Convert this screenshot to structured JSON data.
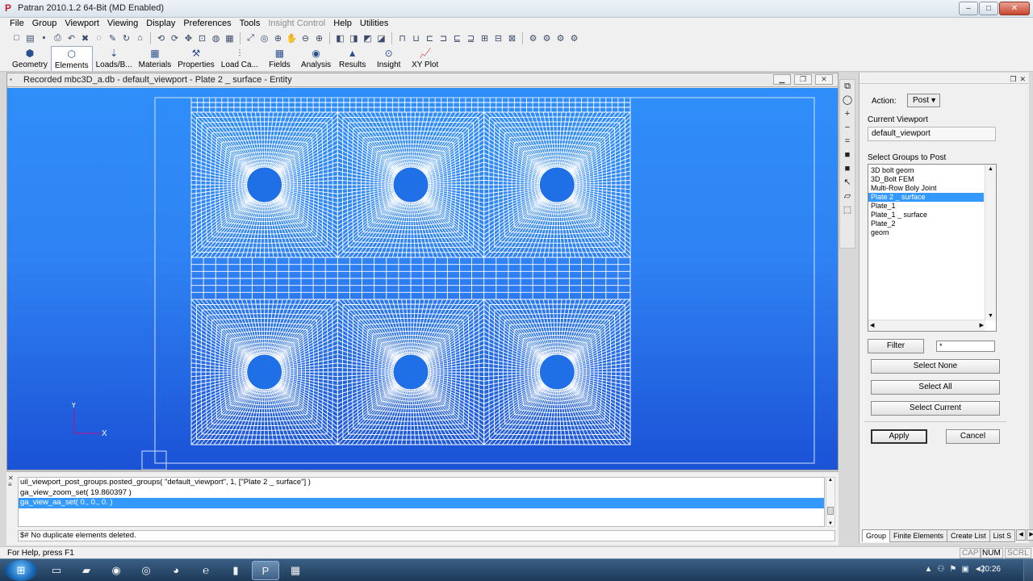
{
  "window": {
    "title": "Patran 2010.1.2 64-Bit (MD Enabled)",
    "app_icon": "P"
  },
  "menubar": [
    {
      "label": "File",
      "disabled": false
    },
    {
      "label": "Group",
      "disabled": false
    },
    {
      "label": "Viewport",
      "disabled": false
    },
    {
      "label": "Viewing",
      "disabled": false
    },
    {
      "label": "Display",
      "disabled": false
    },
    {
      "label": "Preferences",
      "disabled": false
    },
    {
      "label": "Tools",
      "disabled": false
    },
    {
      "label": "Insight Control",
      "disabled": true
    },
    {
      "label": "Help",
      "disabled": false
    },
    {
      "label": "Utilities",
      "disabled": false
    }
  ],
  "toolbar_icons": [
    "new-file-icon",
    "open-file-icon",
    "save-icon",
    "print-icon",
    "undo-icon",
    "abort-icon",
    "reset-graphics-icon",
    "pencil-icon",
    "refresh-icon",
    "home-icon",
    "rotate-icon",
    "rotate-2-icon",
    "translate-icon",
    "zoom-window-icon",
    "shade-icon",
    "view-front-icon",
    "fit-view-icon",
    "center-icon",
    "zoom-center-icon",
    "pan-icon",
    "zoom-out-icon",
    "zoom-in-icon",
    "iso-view-1-icon",
    "iso-view-2-icon",
    "iso-view-3-icon",
    "iso-view-4-icon",
    "view-top-icon",
    "view-bottom-icon",
    "view-front-2-icon",
    "view-rear-icon",
    "view-left-icon",
    "view-right-icon",
    "view-iso-icon",
    "view-persp-icon",
    "view-named-icon",
    "show-labels-icon",
    "hide-labels-icon",
    "label-options-icon",
    "entity-color-icon"
  ],
  "app_tabs": [
    {
      "label": "Geometry",
      "icon": "geometry-icon",
      "active": false
    },
    {
      "label": "Elements",
      "icon": "elements-icon",
      "active": true
    },
    {
      "label": "Loads/B...",
      "icon": "loads-bcs-icon",
      "active": false
    },
    {
      "label": "Materials",
      "icon": "materials-icon",
      "active": false
    },
    {
      "label": "Properties",
      "icon": "properties-icon",
      "active": false
    },
    {
      "label": "Load Ca...",
      "icon": "load-cases-icon",
      "active": false
    },
    {
      "label": "Fields",
      "icon": "fields-icon",
      "active": false
    },
    {
      "label": "Analysis",
      "icon": "analysis-icon",
      "active": false
    },
    {
      "label": "Results",
      "icon": "results-icon",
      "active": false
    },
    {
      "label": "Insight",
      "icon": "insight-icon",
      "active": false
    },
    {
      "label": "XY Plot",
      "icon": "xy-plot-icon",
      "active": false
    }
  ],
  "viewport": {
    "title": "Recorded mbc3D_a.db - default_viewport - Plate 2 _ surface - Entity",
    "bg_top": "#2f8ef9",
    "bg_bottom": "#1b52d6",
    "mesh_color": "#ffffff",
    "triad_x": "X",
    "triad_y": "Y"
  },
  "side_tools": [
    "copy-icon",
    "lasso-icon",
    "plus-icon",
    "minus-icon",
    "equals-icon",
    "gray-square-icon",
    "gray-square-2-icon",
    "pick-arrow-icon",
    "poly-pick-icon",
    "cube-pick-icon"
  ],
  "form": {
    "action_label": "Action:",
    "action_value": "Post",
    "current_viewport_label": "Current Viewport",
    "current_viewport_value": "default_viewport",
    "select_groups_label": "Select Groups to Post",
    "groups": [
      {
        "label": "3D bolt geom",
        "selected": false
      },
      {
        "label": "3D_Bolt FEM",
        "selected": false
      },
      {
        "label": "Multi-Row Boly Joint",
        "selected": false
      },
      {
        "label": "Plate 2 _ surface",
        "selected": true
      },
      {
        "label": "Plate_1",
        "selected": false
      },
      {
        "label": "Plate_1 _ surface",
        "selected": false
      },
      {
        "label": "Plate_2",
        "selected": false
      },
      {
        "label": "geom",
        "selected": false
      }
    ],
    "filter_label": "Filter",
    "filter_value": "*",
    "select_none": "Select None",
    "select_all": "Select All",
    "select_current": "Select Current",
    "apply": "Apply",
    "cancel": "Cancel"
  },
  "form_tabs": [
    {
      "label": "Group",
      "active": true
    },
    {
      "label": "Finite Elements",
      "active": false
    },
    {
      "label": "Create List",
      "active": false
    },
    {
      "label": "List S",
      "active": false
    }
  ],
  "history": {
    "lines": [
      {
        "text": "uil_viewport_post_groups.posted_groups( \"default_viewport\", 1, [\"Plate 2 _ surface\"] )",
        "selected": false
      },
      {
        "text": "ga_view_zoom_set( 19.860397 )",
        "selected": false
      },
      {
        "text": "ga_view_aa_set( 0., 0., 0. )",
        "selected": true
      }
    ],
    "command_line": "$# No duplicate elements deleted."
  },
  "statusbar": {
    "help_text": "For Help, press F1",
    "indicators": [
      {
        "label": "CAP",
        "on": false
      },
      {
        "label": "NUM",
        "on": true
      },
      {
        "label": "SCRL",
        "on": false
      }
    ]
  },
  "taskbar": {
    "items": [
      {
        "icon": "windows-start-icon"
      },
      {
        "icon": "explorer-folder-icon"
      },
      {
        "icon": "folder-icon"
      },
      {
        "icon": "media-icon"
      },
      {
        "icon": "chrome-icon"
      },
      {
        "icon": "firefox-icon"
      },
      {
        "icon": "ie-icon"
      },
      {
        "icon": "app-icon"
      },
      {
        "icon": "patran-icon"
      },
      {
        "icon": "spreadsheet-icon"
      }
    ],
    "clock": "20:26"
  }
}
